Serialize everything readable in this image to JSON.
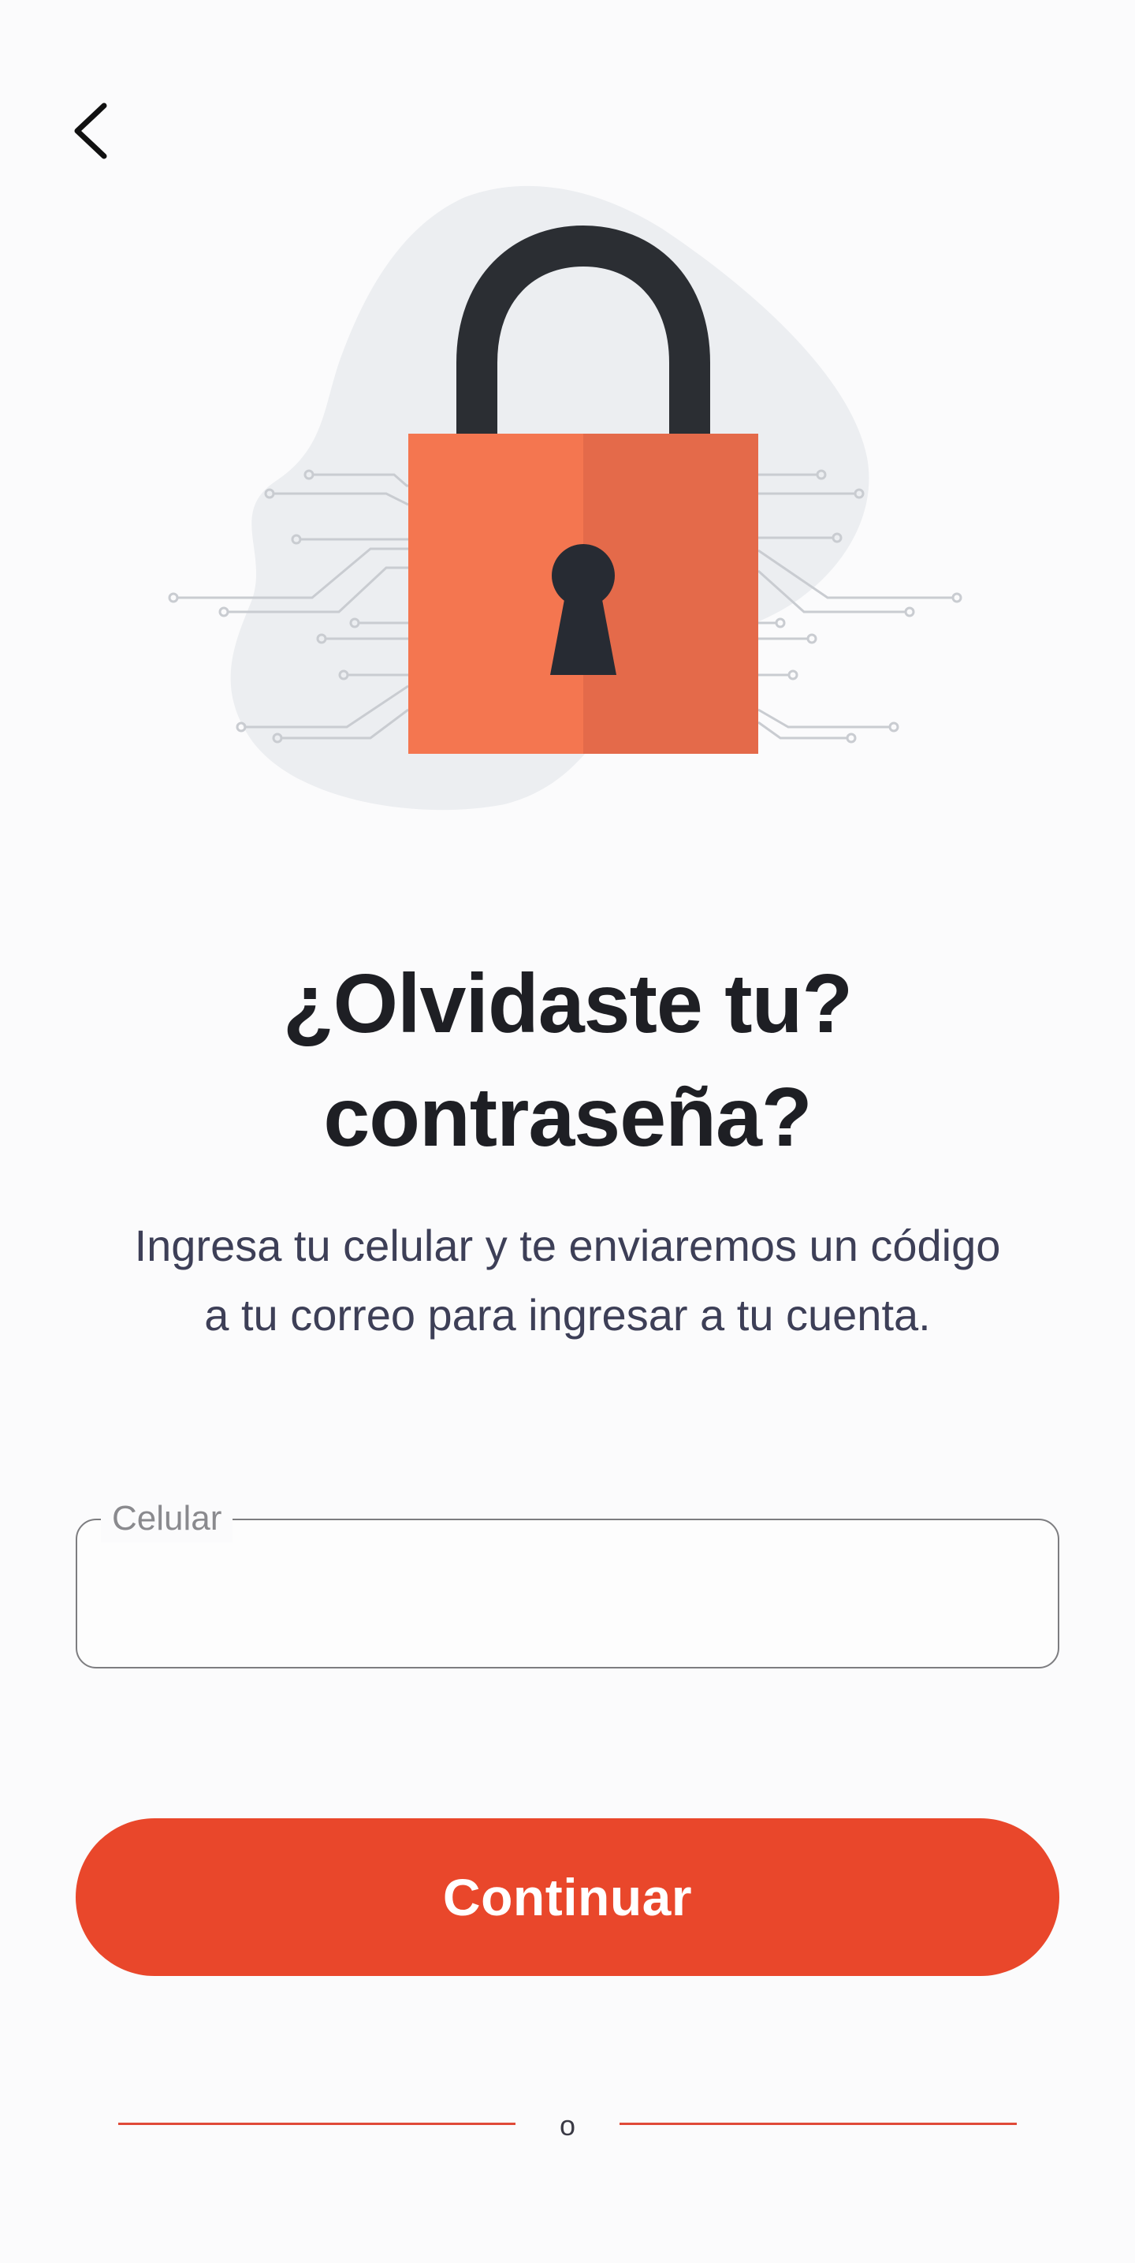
{
  "header": {
    "back_icon": "chevron-left-icon"
  },
  "illustration": {
    "icon": "padlock-icon",
    "colors": {
      "lock_body": "#f47650",
      "lock_body_shade": "#e46a4a",
      "shackle": "#2b2e33",
      "keyhole": "#272b33",
      "blob": "#eceef1",
      "circuit": "#c9ccd1"
    }
  },
  "main": {
    "title_line1": "¿Olvidaste tu?",
    "title_line2": "contraseña?",
    "subtitle": "Ingresa tu celular y te enviaremos un código a tu correo para ingresar a tu cuenta.",
    "phone_field": {
      "label": "Celular",
      "value": ""
    },
    "continue_label": "Continuar",
    "divider_text": "o"
  },
  "colors": {
    "accent": "#e9472b",
    "divider": "#e04a38",
    "title": "#1e1f24",
    "subtitle": "#3d3f57"
  }
}
